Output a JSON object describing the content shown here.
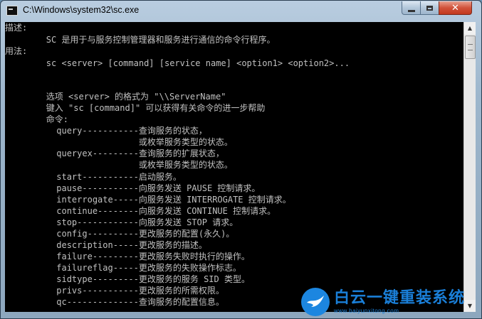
{
  "window": {
    "title": "C:\\Windows\\system32\\sc.exe",
    "icon": "cmd-icon",
    "controls": {
      "minimize": "minimize-icon",
      "maximize": "maximize-icon",
      "close": "close-icon"
    }
  },
  "console": {
    "lines": [
      "描述:",
      "        SC 是用于与服务控制管理器和服务进行通信的命令行程序。",
      "用法:",
      "        sc <server> [command] [service name] <option1> <option2>...",
      "",
      "",
      "        选项 <server> 的格式为 \"\\\\ServerName\"",
      "        键入 \"sc [command]\" 可以获得有关命令的进一步帮助",
      "        命令:",
      "          query-----------查询服务的状态，",
      "                          或枚举服务类型的状态。",
      "          queryex---------查询服务的扩展状态，",
      "                          或枚举服务类型的状态。",
      "          start-----------启动服务。",
      "          pause-----------向服务发送 PAUSE 控制请求。",
      "          interrogate-----向服务发送 INTERROGATE 控制请求。",
      "          continue--------向服务发送 CONTINUE 控制请求。",
      "          stop------------向服务发送 STOP 请求。",
      "          config----------更改服务的配置(永久)。",
      "          description-----更改服务的描述。",
      "          failure---------更改服务失败时执行的操作。",
      "          failureflag-----更改服务的失败操作标志。",
      "          sidtype---------更改服务的服务 SID 类型。",
      "          privs-----------更改服务的所需权限。",
      "          qc--------------查询服务的配置信息。"
    ]
  },
  "scrollbar": {
    "up": "scroll-up-arrow-icon",
    "down": "scroll-down-arrow-icon"
  },
  "watermark": {
    "brand": "白云一键重装系统",
    "url": "www.baiyunxitong.com",
    "logo": "bird-logo-icon"
  },
  "colors": {
    "console_bg": "#000000",
    "console_text": "#c0c0c0",
    "brand": "#1a7fd8"
  }
}
